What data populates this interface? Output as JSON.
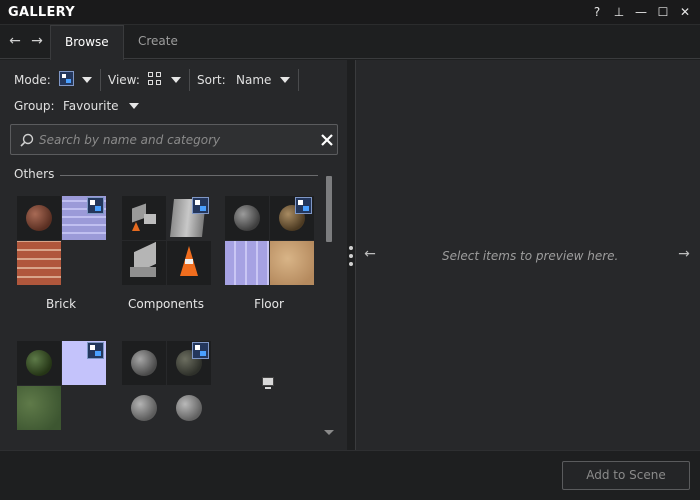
{
  "window": {
    "title": "GALLERY",
    "controls": [
      "?",
      "⊥",
      "—",
      "☐",
      "✕"
    ]
  },
  "tabs": [
    "Browse",
    "Create"
  ],
  "toolbar": {
    "mode_label": "Mode:",
    "view_label": "View:",
    "sort_label": "Sort:",
    "sort_value": "Name",
    "group_label": "Group:",
    "group_value": "Favourite"
  },
  "search": {
    "placeholder": "Search by name and category",
    "value": ""
  },
  "section": "Others",
  "groups": [
    "Brick",
    "Components",
    "Floor"
  ],
  "preview": {
    "hint": "Select items to preview here."
  },
  "footer": {
    "add_button": "Add to Scene"
  },
  "colors": {
    "background": "#1e1f20",
    "panel": "#27282a",
    "accent_badge": "#24375c"
  }
}
